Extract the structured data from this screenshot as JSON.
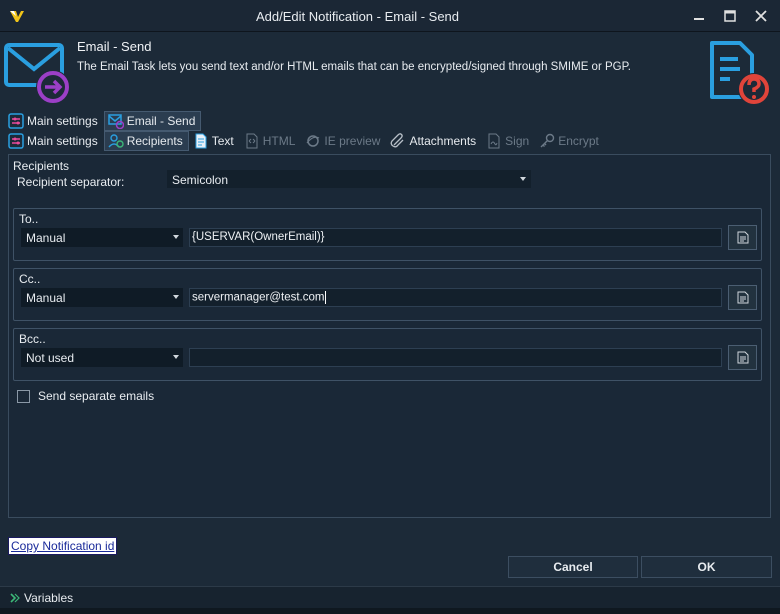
{
  "window": {
    "title": "Add/Edit Notification - Email - Send",
    "controls": [
      "minimize-icon",
      "maximize-icon",
      "close-icon"
    ]
  },
  "header": {
    "title": "Email - Send",
    "description": "The Email Task lets you send text and/or HTML emails that can be encrypted/signed through SMIME or PGP.",
    "icon": "email-send-icon",
    "help_icon": "help-document-icon"
  },
  "tabs_top": [
    {
      "label": "Main settings",
      "icon": "settings-sliders-icon",
      "active": false
    },
    {
      "label": "Email - Send",
      "icon": "email-send-icon",
      "active": true
    }
  ],
  "tabs_sub": [
    {
      "label": "Main settings",
      "icon": "settings-sliders-icon",
      "active": false,
      "disabled": false
    },
    {
      "label": "Recipients",
      "icon": "recipients-icon",
      "active": true,
      "disabled": false
    },
    {
      "label": "Text",
      "icon": "text-document-icon",
      "active": false,
      "disabled": false
    },
    {
      "label": "HTML",
      "icon": "html-icon",
      "active": false,
      "disabled": true
    },
    {
      "label": "IE preview",
      "icon": "ie-preview-icon",
      "active": false,
      "disabled": true
    },
    {
      "label": "Attachments",
      "icon": "paperclip-icon",
      "active": false,
      "disabled": false
    },
    {
      "label": "Sign",
      "icon": "sign-icon",
      "active": false,
      "disabled": true
    },
    {
      "label": "Encrypt",
      "icon": "key-icon",
      "active": false,
      "disabled": true
    }
  ],
  "recipients": {
    "section_title": "Recipients",
    "separator_label": "Recipient separator:",
    "separator_value": "Semicolon",
    "to": {
      "label": "To..",
      "mode": "Manual",
      "value": "{USERVAR(OwnerEmail)}"
    },
    "cc": {
      "label": "Cc..",
      "mode": "Manual",
      "value": "servermanager@test.com"
    },
    "bcc": {
      "label": "Bcc..",
      "mode": "Not used",
      "value": ""
    },
    "send_separate_label": "Send separate emails",
    "send_separate_checked": false
  },
  "footer": {
    "copy_link": "Copy Notification id",
    "cancel": "Cancel",
    "ok": "OK"
  },
  "statusbar": {
    "variables": "Variables"
  },
  "colors": {
    "background": "#1c2a38",
    "accent_blue": "#2a9fe0",
    "accent_purple": "#9b3fc7",
    "help_red": "#e0443a"
  }
}
